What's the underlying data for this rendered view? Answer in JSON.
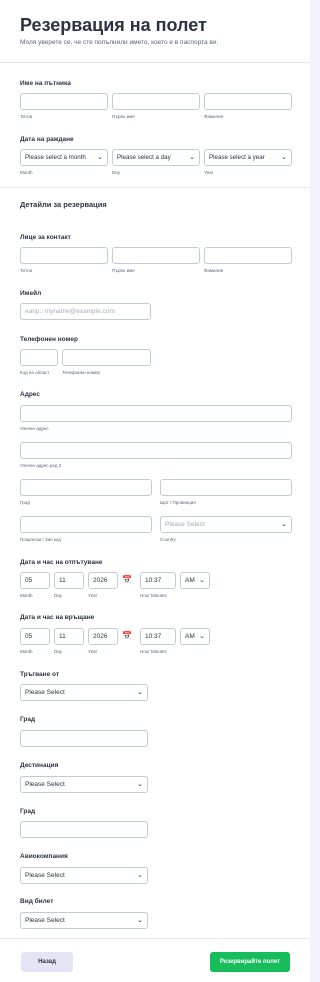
{
  "header": {
    "title": "Резервация на полет",
    "subtitle": "Моля уверете се, че сте попълнили името, което е в паспорта ви."
  },
  "passenger": {
    "label": "Име на пътника",
    "sub_title": "Титла",
    "sub_first": "Първо име",
    "sub_last": "Фамилия"
  },
  "birth": {
    "label": "Дата на раждане",
    "month": "Please select a month",
    "day": "Please select a day",
    "year": "Please select a year",
    "sub_month": "Month",
    "sub_day": "Day",
    "sub_year": "Year"
  },
  "details_section": "Детайли за резервация",
  "contact": {
    "label": "Лице за контакт",
    "sub_title": "Титла",
    "sub_first": "Първо име",
    "sub_last": "Фамилия"
  },
  "email": {
    "label": "Имейл",
    "placeholder": "напр.: myname@example.com"
  },
  "phone": {
    "label": "Телефонен номер",
    "sub_area": "Код на област",
    "sub_number": "Телефонен номер"
  },
  "address": {
    "label": "Адрес",
    "sub_street": "Уличен адрес",
    "sub_street2": "Уличен адрес ред 2",
    "sub_city": "Град",
    "sub_state": "Щат / Провинция",
    "sub_zip": "Пощенски / Зип код",
    "country_placeholder": "Please Select",
    "sub_country": "Country"
  },
  "departure": {
    "label": "Дата и час на отпътуване",
    "month": "05",
    "day": "11",
    "year": "2026",
    "time": "10:37",
    "ampm": "AM",
    "sub_month": "Month",
    "sub_day": "Day",
    "sub_year": "Year",
    "sub_time": "Hour Minutes"
  },
  "return": {
    "label": "Дата и час на връщане",
    "month": "05",
    "day": "11",
    "year": "2026",
    "time": "10:37",
    "ampm": "AM",
    "sub_month": "Month",
    "sub_day": "Day",
    "sub_year": "Year",
    "sub_time": "Hour Minutes"
  },
  "from": {
    "label": "Тръгване от",
    "value": "Please Select"
  },
  "from_city": {
    "label": "Град"
  },
  "destination": {
    "label": "Дестинация",
    "value": "Please Select"
  },
  "dest_city": {
    "label": "Град"
  },
  "airline": {
    "label": "Авиокомпания",
    "value": "Please Select"
  },
  "ticket": {
    "label": "Вид билет",
    "value": "Please Select"
  },
  "footer": {
    "back": "Назад",
    "submit": "Резервирайте полет"
  },
  "icons": {
    "chevron": "chevron-down-icon",
    "calendar": "calendar-icon"
  },
  "colors": {
    "submit": "#18bd5b",
    "back": "#e3e5f5",
    "text": "#2c3345",
    "border": "#c3cad8"
  }
}
